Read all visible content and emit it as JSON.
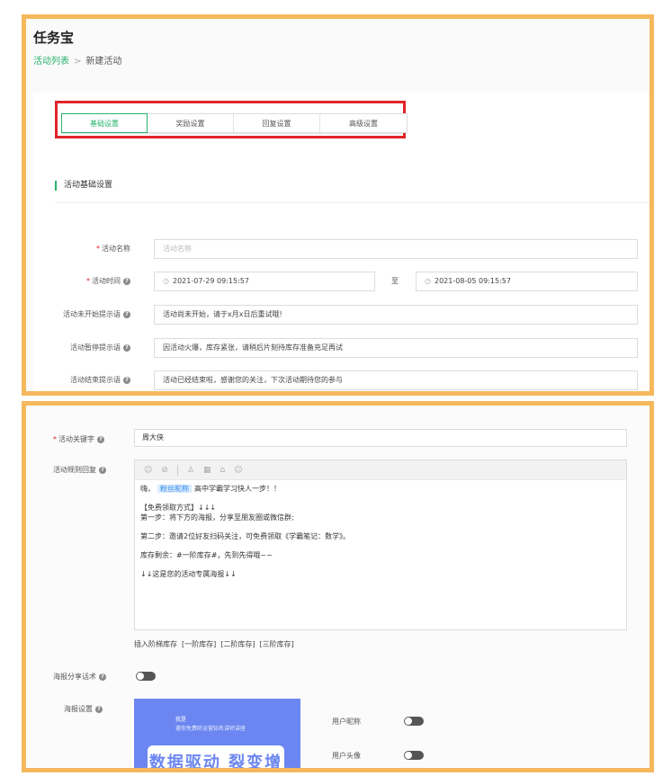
{
  "app": {
    "title": "任务宝"
  },
  "breadcrumb": {
    "parent": "活动列表",
    "separator": ">",
    "current": "新建活动"
  },
  "tabs": [
    {
      "label": "基础设置",
      "active": true
    },
    {
      "label": "奖励设置",
      "active": false
    },
    {
      "label": "回复设置",
      "active": false
    },
    {
      "label": "高级设置",
      "active": false
    }
  ],
  "section": {
    "title": "活动基础设置"
  },
  "form": {
    "name": {
      "label": "活动名称",
      "required": true,
      "placeholder": "活动名称"
    },
    "time": {
      "label": "活动时间",
      "required": true,
      "start": "2021-07-29 09:15:57",
      "to": "至",
      "end": "2021-08-05 09:15:57"
    },
    "not_started": {
      "label": "活动未开始提示语",
      "value": "活动尚未开始，请于x月x日后重试哦!"
    },
    "paused": {
      "label": "活动暂停提示语",
      "value": "因活动火爆，库存紧张，请稍后片刻待库存准备充足再试"
    },
    "ended": {
      "label": "活动结束提示语",
      "value": "活动已经结束啦，感谢您的关注，下次活动期待您的参与"
    }
  },
  "bottom": {
    "keyword": {
      "label": "活动关键字",
      "required": true,
      "value": "周大侠"
    },
    "reply": {
      "label": "活动规则回复",
      "toolbar_icons": [
        "smile-icon",
        "link-icon",
        "user-icon",
        "image-icon",
        "miniapp-icon",
        "emoji-icon"
      ],
      "toolbar_glyphs": [
        "☺",
        "⊘",
        "♙",
        "▦",
        "⌂",
        "☺"
      ],
      "line1_prefix": "嗨，",
      "nickname_tag": "粉丝昵称",
      "line1_suffix": "高中学霸学习快人一步！！",
      "line2": "【免费领取方式】↓↓↓",
      "line3": "第一步：将下方的海报，分享至朋友圈或微信群;",
      "line4": "第二步：邀请2位好友扫码关注，可免费领取《学霸笔记：数学》。",
      "line5": "库存剩余：#一阶库存#，先到先得哦~~",
      "line6": "↓↓这是您的活动专属海报↓↓"
    },
    "insert": {
      "label": "插入阶梯库存",
      "links": [
        "[一阶库存]",
        "[二阶库存]",
        "[三阶库存]"
      ]
    },
    "share_text": {
      "label": "海报分享话术",
      "enabled": false
    },
    "poster": {
      "label": "海报设置",
      "line1": "我是",
      "line2": "邀你免费听运营知名讲师讲座",
      "headline": "数据驱动 裂变增长",
      "options": [
        {
          "label": "用户昵称",
          "enabled": false
        },
        {
          "label": "用户头像",
          "enabled": false
        }
      ]
    }
  },
  "colors": {
    "accent": "#26b36a",
    "highlight_box": "#e0252a",
    "frame": "#f5b85c",
    "poster": "#6b86f0"
  }
}
